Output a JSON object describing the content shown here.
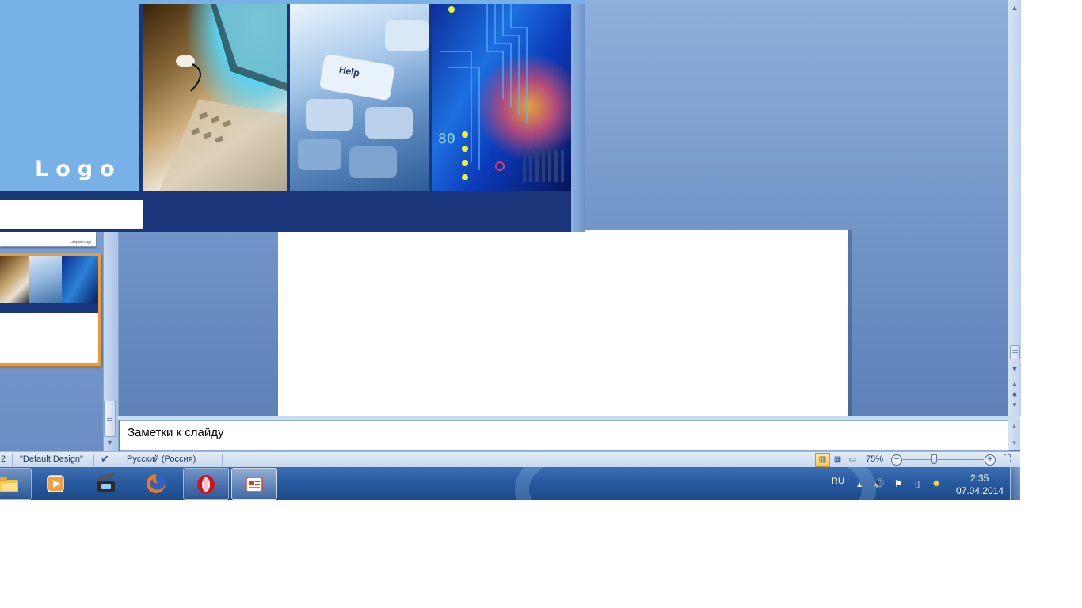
{
  "slide_header": {
    "logo_text": "Logo",
    "keyboard_key_text": "Help",
    "circuit_text": "80"
  },
  "thumbnails": {
    "previous_caption": "Company Logo"
  },
  "notes": {
    "placeholder": "Заметки к слайду"
  },
  "status_bar": {
    "slide_number_fragment": "2",
    "theme": "\"Default Design\"",
    "language": "Русский (Россия)",
    "zoom": "75%",
    "zoom_fraction": 0.75
  },
  "taskbar": {
    "apps": [
      {
        "name": "Windows Explorer",
        "icon": "folder-icon"
      },
      {
        "name": "Media Player",
        "icon": "media-player-icon"
      },
      {
        "name": "Video Editor",
        "icon": "clapperboard-icon"
      },
      {
        "name": "Firefox",
        "icon": "firefox-icon"
      },
      {
        "name": "Opera",
        "icon": "opera-icon"
      },
      {
        "name": "PowerPoint",
        "icon": "powerpoint-icon"
      }
    ],
    "language": "RU",
    "time": "2:35",
    "date": "07.04.2014"
  },
  "colors": {
    "banner_navy": "#1b357b",
    "logo_panel": "#78b1e5",
    "active_thumbnail_border": "#e89c3c",
    "taskbar": "#2a5aa0"
  }
}
